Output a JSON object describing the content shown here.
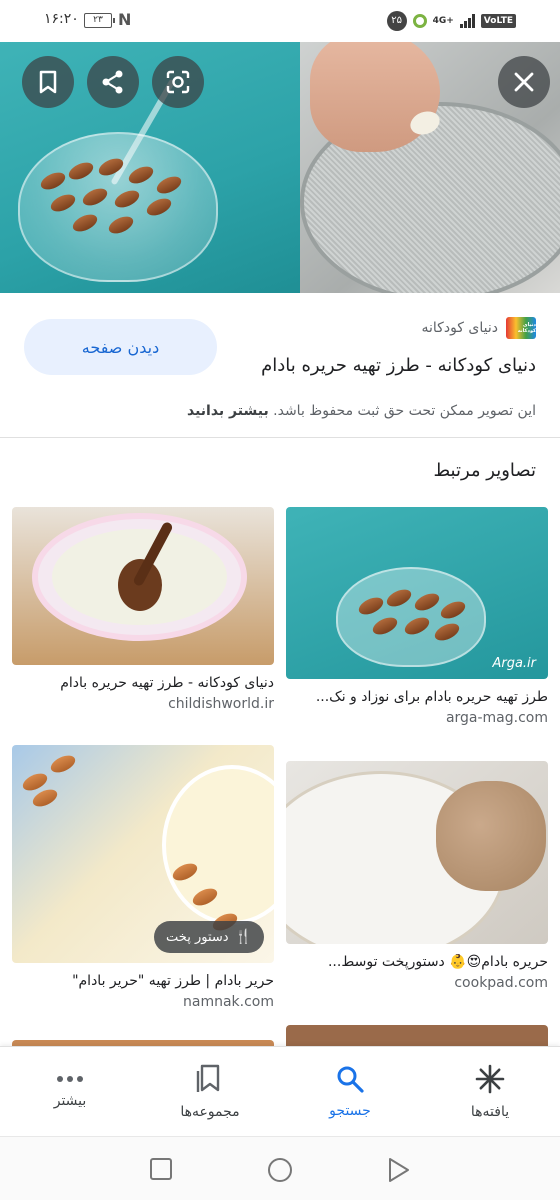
{
  "status_bar": {
    "time": "۱۶:۲۰",
    "battery": "۲۳",
    "notification_count": "۲۵",
    "network": "4G+",
    "volte": "VoLTE"
  },
  "hero": {
    "save_icon": "bookmark-icon",
    "share_icon": "share-icon",
    "lens_icon": "lens-icon",
    "close_icon": "close-icon"
  },
  "info": {
    "source_logo_text": "دنیای کودکانه",
    "source_name": "دنیای کودکانه",
    "title": "دنیای کودکانه - طرز تهیه حریره بادام",
    "visit_label": "دیدن صفحه",
    "copyright_text": "این تصویر ممکن تحت حق ثبت محفوظ باشد.",
    "learn_more": "بیشتر بدانید"
  },
  "related": {
    "title": "تصاویر مرتبط",
    "items": [
      {
        "caption": "طرز تهیه حریره بادام برای نوزاد و نک...",
        "domain": "arga-mag.com",
        "watermark": "Arga.ir"
      },
      {
        "caption": "دنیای کودکانه - طرز تهیه حریره بادام",
        "domain": "childishworld.ir"
      },
      {
        "caption": "حریره بادام😍👶 دستورپخت توسط...",
        "domain": "cookpad.com"
      },
      {
        "caption": "حریر بادام | طرز تهیه \"حریر بادام\"",
        "domain": "namnak.com",
        "badge": "دستور پخت"
      }
    ]
  },
  "bottom_nav": {
    "items": [
      {
        "label": "یافته‌ها",
        "icon": "discover-icon"
      },
      {
        "label": "جستجو",
        "icon": "search-icon"
      },
      {
        "label": "مجموعه‌ها",
        "icon": "collections-icon"
      },
      {
        "label": "بیشتر",
        "icon": "more-icon"
      }
    ]
  },
  "colors": {
    "accent": "#1a73e8",
    "visit_button_bg": "#e8f0fe",
    "visit_button_text": "#1967d2"
  }
}
